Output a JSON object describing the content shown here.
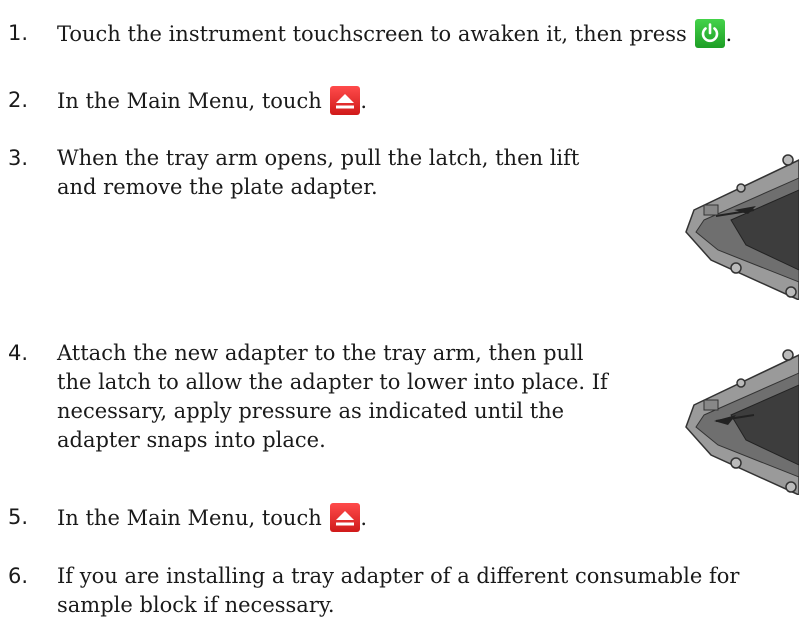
{
  "steps": [
    {
      "number": "1.",
      "lines": [
        "Touch the instrument touchscreen to awaken it, then press"
      ],
      "icon": "power-icon",
      "trailing": "."
    },
    {
      "number": "2.",
      "lines": [
        "In the Main Menu, touch"
      ],
      "icon": "eject-icon",
      "trailing": "."
    },
    {
      "number": "3.",
      "lines": [
        "When the tray arm opens, pull the latch, then lift",
        "and remove the plate adapter."
      ]
    },
    {
      "number": "4.",
      "lines": [
        "Attach the new adapter to the tray arm, then pull",
        "the latch to allow the adapter to lower into place. If",
        "necessary, apply pressure as indicated until the",
        "adapter snaps into place."
      ]
    },
    {
      "number": "5.",
      "lines": [
        "In the Main Menu, touch"
      ],
      "icon": "eject-icon",
      "trailing": "."
    },
    {
      "number": "6.",
      "lines": [
        "If you are installing a tray adapter of a different consumable for",
        "sample block if necessary."
      ]
    }
  ],
  "colors": {
    "power": "#2fbf36",
    "eject": "#e52b2b",
    "tray_gray": "#8a8a8a",
    "tray_dark": "#3a3a3a"
  }
}
